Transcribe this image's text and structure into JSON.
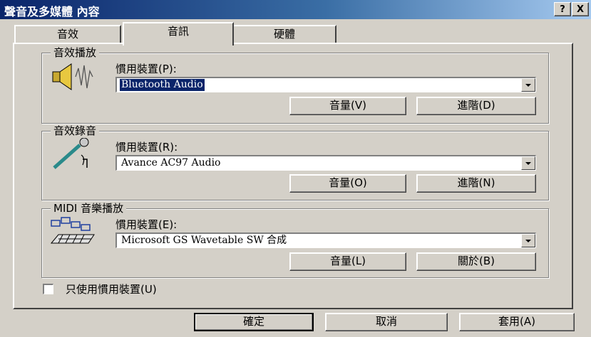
{
  "window": {
    "title": "聲音及多媒體 內容",
    "help_label": "?",
    "close_label": "X"
  },
  "tabs": [
    {
      "label": "音效",
      "selected": false
    },
    {
      "label": "音訊",
      "selected": true
    },
    {
      "label": "硬體",
      "selected": false
    }
  ],
  "sound_playback": {
    "legend": "音效播放",
    "device_label": "慣用裝置(P):",
    "device_value": "Bluetooth Audio",
    "icon": "speaker-icon",
    "volume_label": "音量(V)",
    "advanced_label": "進階(D)"
  },
  "sound_recording": {
    "legend": "音效錄音",
    "device_label": "慣用裝置(R):",
    "device_value": "Avance AC97 Audio",
    "icon": "microphone-icon",
    "volume_label": "音量(O)",
    "advanced_label": "進階(N)"
  },
  "midi_playback": {
    "legend": "MIDI 音樂播放",
    "device_label": "慣用裝置(E):",
    "device_value": "Microsoft GS Wavetable SW 合成",
    "icon": "midi-keyboard-icon",
    "volume_label": "音量(L)",
    "about_label": "關於(B)"
  },
  "use_preferred_only": {
    "label": "只使用慣用裝置(U)",
    "checked": false
  },
  "footer": {
    "ok_label": "確定",
    "cancel_label": "取消",
    "apply_label": "套用(A)"
  }
}
